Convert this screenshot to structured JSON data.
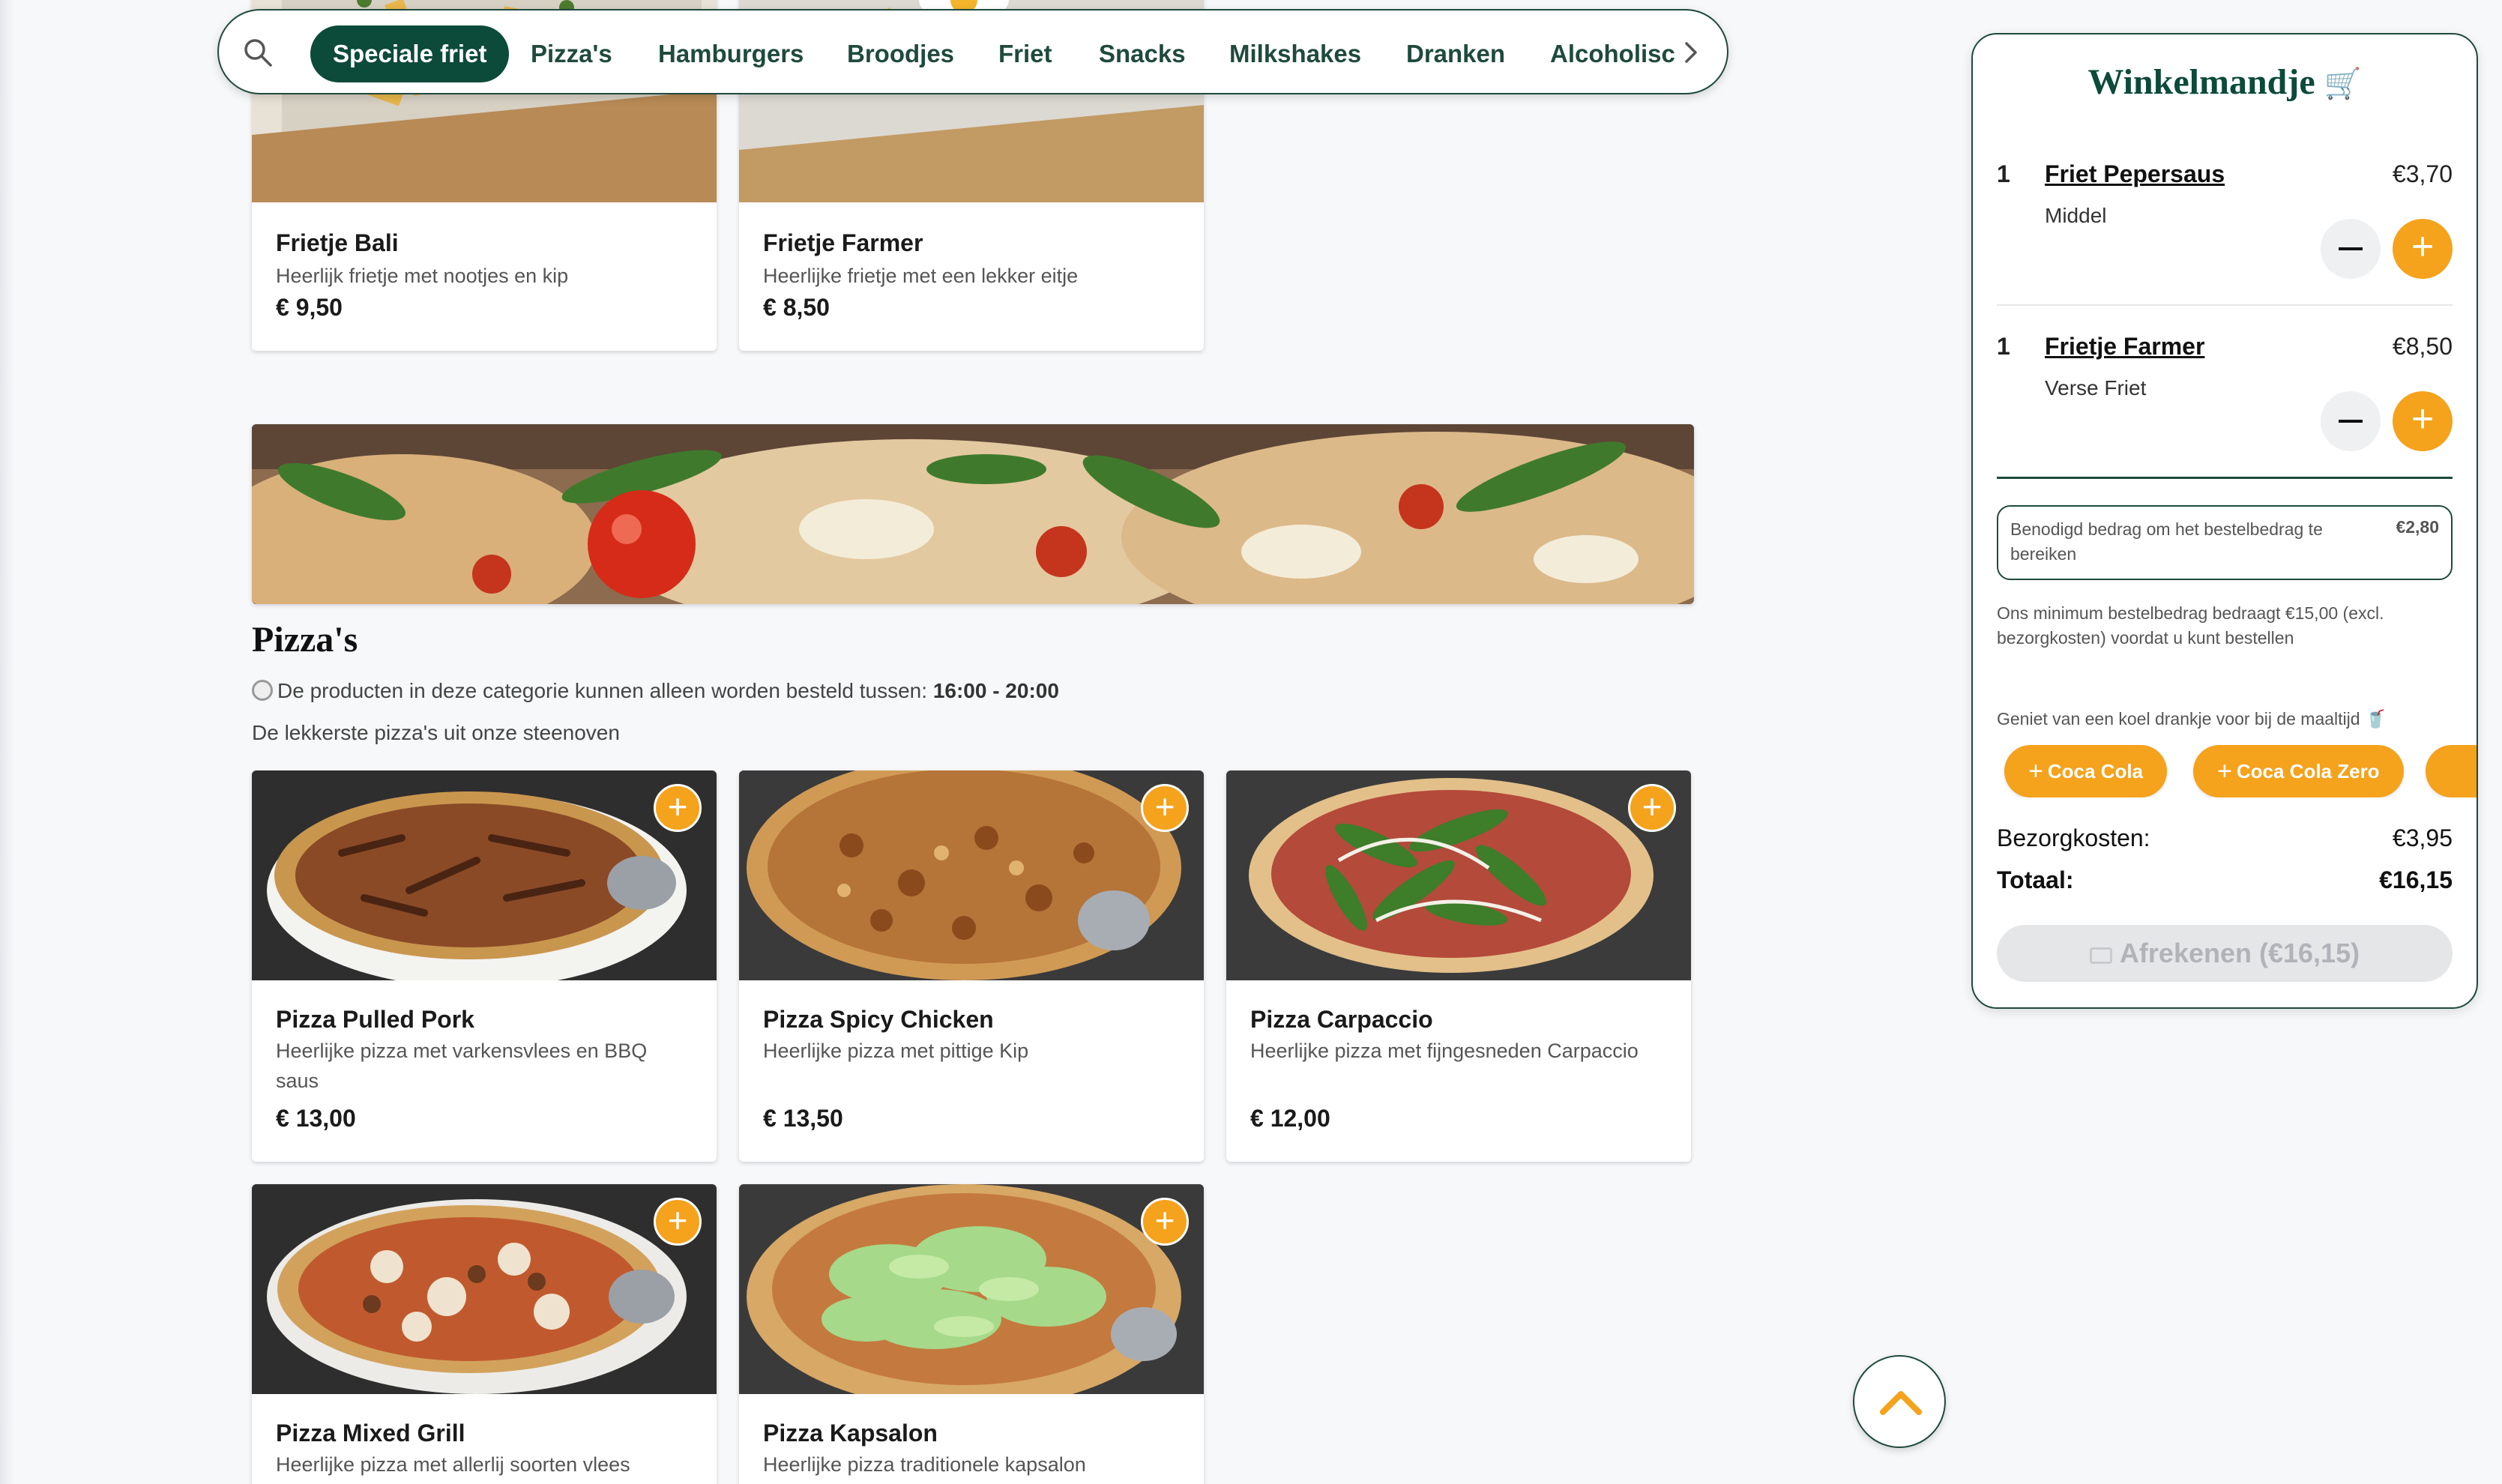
{
  "nav": {
    "items": [
      "Speciale friet",
      "Pizza's",
      "Hamburgers",
      "Broodjes",
      "Friet",
      "Snacks",
      "Milkshakes",
      "Dranken",
      "Alcoholisc"
    ],
    "active_index": 0
  },
  "top_products": [
    {
      "name": "Frietje Bali",
      "desc": "Heerlijk frietje met nootjes en kip",
      "price": "€ 9,50"
    },
    {
      "name": "Frietje Farmer",
      "desc": "Heerlijke frietje met een lekker eitje",
      "price": "€ 8,50"
    }
  ],
  "category": {
    "title": "Pizza's",
    "time_prefix": "De producten in deze categorie kunnen alleen worden besteld tussen:",
    "time_range": "16:00 - 20:00",
    "subtitle": "De lekkerste pizza's uit onze steenoven"
  },
  "pizzas": [
    {
      "name": "Pizza Pulled Pork",
      "desc": "Heerlijke pizza met varkensvlees en BBQ saus",
      "price": "€ 13,00"
    },
    {
      "name": "Pizza Spicy Chicken",
      "desc": "Heerlijke pizza met pittige Kip",
      "price": "€ 13,50"
    },
    {
      "name": "Pizza Carpaccio",
      "desc": "Heerlijke pizza met fijngesneden Carpaccio",
      "price": "€ 12,00"
    },
    {
      "name": "Pizza Mixed Grill",
      "desc": "Heerlijke pizza met allerlij soorten vlees",
      "price": ""
    },
    {
      "name": "Pizza Kapsalon",
      "desc": "Heerlijke pizza traditionele kapsalon",
      "price": ""
    }
  ],
  "add_symbol": "+",
  "cart": {
    "title": "Winkelmandje",
    "title_icon": "🛒",
    "items": [
      {
        "qty": "1",
        "name": "Friet Pepersaus",
        "option": "Middel",
        "price": "€3,70"
      },
      {
        "qty": "1",
        "name": "Frietje Farmer",
        "option": "Verse Friet",
        "price": "€8,50"
      }
    ],
    "min_needed_text": "Benodigd bedrag om het bestelbedrag te bereiken",
    "min_needed_amount": "€2,80",
    "min_note": "Ons minimum bestelbedrag bedraagt €15,00 (excl. bezorgkosten) voordat u kunt bestellen",
    "drink_note": "Geniet van een koel drankje voor bij de maaltijd 🥤",
    "drinks": [
      "Coca Cola",
      "Coca Cola Zero",
      ""
    ],
    "delivery_label": "Bezorgkosten:",
    "delivery_value": "€3,95",
    "total_label": "Totaal:",
    "total_value": "€16,15",
    "checkout_label": "Afrekenen (€16,15)"
  },
  "colors": {
    "brand_green": "#0c4a3a",
    "accent_orange": "#f5a21c"
  },
  "icons": [
    "search-icon",
    "chevron-right-icon",
    "clock-icon",
    "cart-icon",
    "plus-icon",
    "minus-icon",
    "chevron-up-icon"
  ]
}
